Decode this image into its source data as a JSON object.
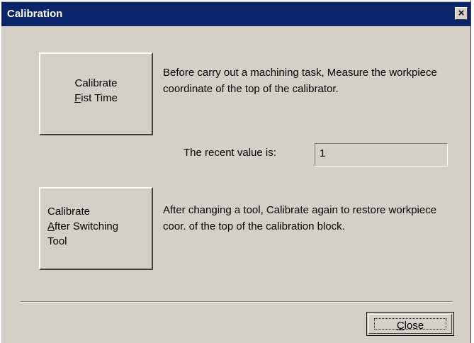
{
  "dialog": {
    "title": "Calibration",
    "title_close_glyph": "×",
    "calibrate_first": {
      "mnemonic": "F",
      "rest": "ist Time",
      "line1": "Calibrate"
    },
    "first_desc": "Before carry out a machining task, Measure the workpiece coordinate of the top of the calibrator.",
    "recent_label": "The recent value is:",
    "recent_value": "1",
    "calibrate_after": {
      "line1": "Calibrate",
      "mnemonic": "A",
      "rest": "fter Switching",
      "line3": "Tool"
    },
    "after_desc": "After changing a tool, Calibrate again to restore workpiece coor. of the top of the calibration block.",
    "close_button": {
      "mnemonic": "C",
      "rest": "lose"
    }
  },
  "colors": {
    "face": "#d4d0c8",
    "titlebar": "#0a246a",
    "title_text": "#ffffff"
  }
}
